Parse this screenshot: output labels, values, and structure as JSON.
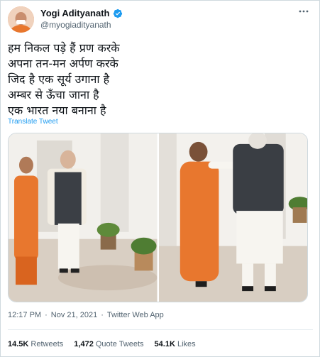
{
  "author": {
    "display_name": "Yogi Adityanath",
    "handle": "@myogiadityanath",
    "verified_color": "#1d9bf0"
  },
  "tweet": {
    "text": "हम निकल पड़े हैं प्रण करके\nअपना तन-मन अर्पण करके\nजिद है एक सूर्य उगाना है\nअम्बर से ऊँचा जाना है\nएक भारत नया बनाना है",
    "translate_label": "Translate Tweet"
  },
  "meta": {
    "time": "12:17 PM",
    "separator": "·",
    "date": "Nov 21, 2021",
    "source": "Twitter Web App"
  },
  "stats": {
    "retweets_count": "14.5K",
    "retweets_label": "Retweets",
    "quotes_count": "1,472",
    "quotes_label": "Quote Tweets",
    "likes_count": "54.1K",
    "likes_label": "Likes"
  },
  "colors": {
    "accent": "#1d9bf0",
    "saffron": "#e8772e",
    "secondary_text": "#536471"
  },
  "icons": {
    "verified": "verified-badge-icon",
    "more": "more-options-icon"
  }
}
